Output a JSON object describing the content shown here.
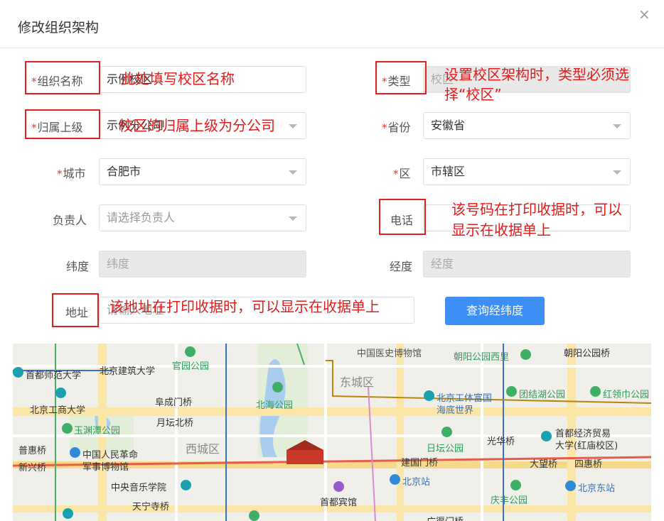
{
  "dialog": {
    "title": "修改组织架构",
    "close_icon": "×"
  },
  "form": {
    "org_name": {
      "label": "组织名称",
      "value": "示例校区"
    },
    "type": {
      "label": "类型",
      "value": "校区"
    },
    "parent": {
      "label": "归属上级",
      "value": "示例分公司"
    },
    "province": {
      "label": "省份",
      "value": "安徽省"
    },
    "city": {
      "label": "城市",
      "value": "合肥市"
    },
    "district": {
      "label": "区",
      "value": "市辖区"
    },
    "manager": {
      "label": "负责人",
      "placeholder": "请选择负责人"
    },
    "phone": {
      "label": "电话",
      "value": ""
    },
    "latitude": {
      "label": "纬度",
      "placeholder": "纬度"
    },
    "longitude": {
      "label": "经度",
      "placeholder": "经度"
    },
    "address": {
      "label": "地址",
      "placeholder": "请输入地址"
    },
    "search_button": "查询经纬度"
  },
  "annotations": {
    "org_name": "此处填写校区名称",
    "type_line1": "设置校区架构时，类型必须选",
    "type_line2": "择“校区”",
    "parent": "校区的归属上级为分公司",
    "phone_line1": "该号码在打印收据时，可以",
    "phone_line2": "显示在收据单上",
    "address": "该地址在打印收据时，可以显示在收据单上"
  },
  "map": {
    "districts": [
      "东城区",
      "西城区"
    ],
    "pois": [
      "中国医史博物馆",
      "朝阳公园西里",
      "朝阳公园桥",
      "首都师范大学",
      "北京建筑大学",
      "官园公园",
      "北京工体富国",
      "海底世界",
      "团结湖公园",
      "红领巾公园",
      "北京工商大学",
      "阜成门桥",
      "北海公园",
      "玉渊潭公园",
      "月坛北桥",
      "日坛公园",
      "光华桥",
      "首都经济贸易",
      "大学(红庙校区)",
      "普惠桥",
      "中国人民革命",
      "军事博物馆",
      "新兴桥",
      "建国门桥",
      "大望桥",
      "四惠桥",
      "北京站",
      "中央音乐学院",
      "北京东站",
      "天宁寺桥",
      "首都宾馆",
      "庆丰公园",
      "广渠门桥"
    ]
  }
}
